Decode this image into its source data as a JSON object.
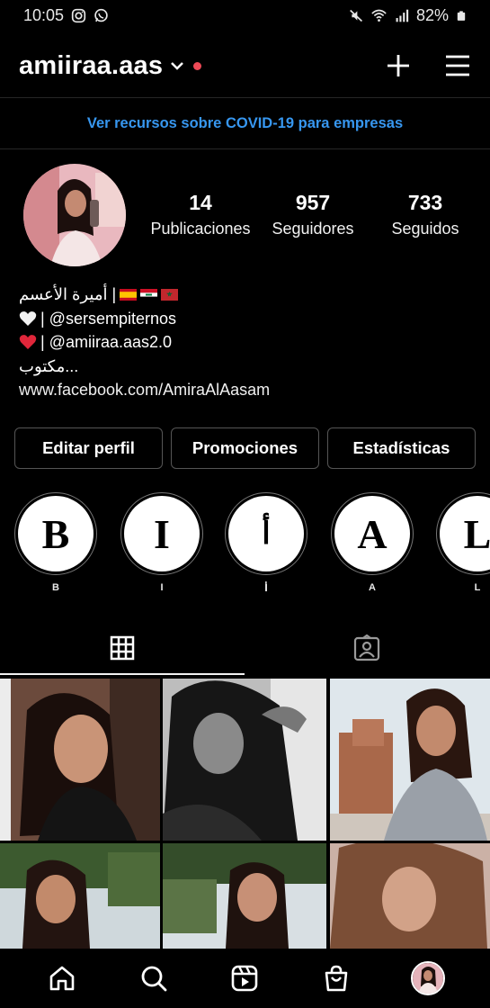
{
  "status_bar": {
    "time": "10:05",
    "battery": "82%"
  },
  "header": {
    "username": "amiiraa.aas",
    "icons": [
      "chevron-down-icon",
      "notification-dot",
      "plus-icon",
      "menu-icon"
    ],
    "accent_dot_color": "#ed4956"
  },
  "banner": {
    "text": "Ver recursos sobre COVID-19 para empresas",
    "color": "#3797f0"
  },
  "profile": {
    "stats": [
      {
        "value": "14",
        "label": "Publicaciones"
      },
      {
        "value": "957",
        "label": "Seguidores"
      },
      {
        "value": "733",
        "label": "Seguidos"
      }
    ],
    "bio": {
      "line1": "أميرة الأعسم |",
      "line2": "| @sersempiternos",
      "line3": "| @amiiraa.aas2.0",
      "line4": "مكتوب...",
      "website": "www.facebook.com/AmiraAlAasam"
    }
  },
  "actions": {
    "edit": "Editar perfil",
    "promotions": "Promociones",
    "stats": "Estadísticas"
  },
  "highlights": [
    {
      "letter": "B",
      "label": "B"
    },
    {
      "letter": "I",
      "label": "I"
    },
    {
      "letter": "أ",
      "label": "أ"
    },
    {
      "letter": "A",
      "label": "A"
    },
    {
      "letter": "L",
      "label": "L"
    }
  ],
  "tabs": [
    {
      "name": "grid-icon",
      "active": true
    },
    {
      "name": "tagged-icon",
      "active": false
    }
  ],
  "bottom_nav": [
    "home-icon",
    "search-icon",
    "reels-icon",
    "shop-icon",
    "profile-avatar"
  ]
}
